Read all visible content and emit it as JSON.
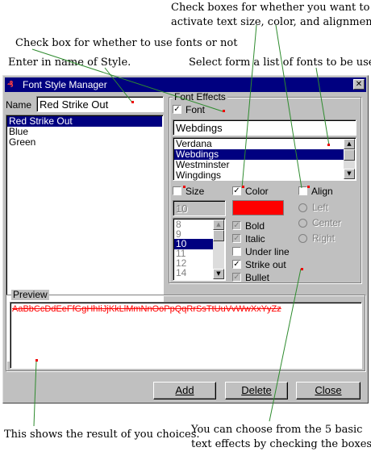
{
  "annotations": {
    "checkbox_effects_line1": "Check boxes for whether you want to",
    "checkbox_effects_line2": "activate text size, color, and alignment.",
    "checkbox_fonts": "Check box for whether to use fonts or not",
    "enter_style_name": "Enter in name of Style.",
    "select_fonts": "Select form a list of fonts to be used.",
    "preview_result": "This shows the result of you choices.",
    "five_effects_line1": "You can choose from the 5 basic",
    "five_effects_line2": "text effects by checking the boxes."
  },
  "window": {
    "title": "Font Style Manager",
    "close_glyph": "✕"
  },
  "name_field": {
    "label": "Name",
    "value": "Red Strike Out"
  },
  "styles_list": {
    "items": [
      "Red Strike Out",
      "Blue",
      "Green"
    ],
    "selected": "Red Strike Out"
  },
  "font_effects": {
    "group_title": "Font Effects",
    "font_checkbox": {
      "label": "Font",
      "checked": true
    },
    "font_value": "Webdings",
    "fonts": [
      "Verdana",
      "Webdings",
      "Westminster",
      "Wingdings"
    ],
    "selected_font": "Webdings",
    "size": {
      "label": "Size",
      "checked": false,
      "value": "10",
      "options": [
        "8",
        "9",
        "10",
        "11",
        "12",
        "14"
      ],
      "selected": "10"
    },
    "color": {
      "label": "Color",
      "checked": true,
      "swatch": "#ff0000"
    },
    "align": {
      "label": "Align",
      "checked": false,
      "options": [
        "Left",
        "Center",
        "Right"
      ]
    },
    "effects": [
      {
        "label": "Bold",
        "checked": false
      },
      {
        "label": "Italic",
        "checked": false
      },
      {
        "label": "Under line",
        "checked": false
      },
      {
        "label": "Strike out",
        "checked": true
      },
      {
        "label": "Bullet",
        "checked": false
      }
    ]
  },
  "preview": {
    "title": "Preview",
    "sample": "AaBbCcDdEeFfGgHhIiJjKkLlMmNnOoPpQqRrSsTtUuVvWwXxYyZz",
    "sample_color": "#ff0000"
  },
  "buttons": {
    "add": "Add",
    "delete": "Delete",
    "close": "Close"
  }
}
